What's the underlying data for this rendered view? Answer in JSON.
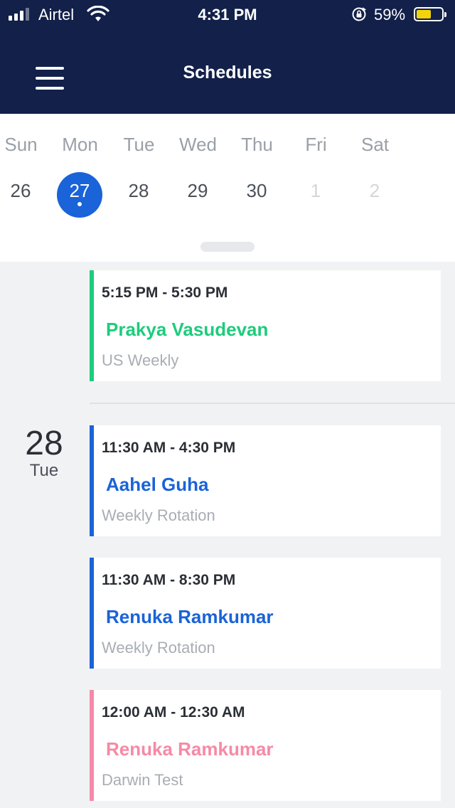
{
  "status_bar": {
    "carrier": "Airtel",
    "time": "4:31 PM",
    "battery": "59%",
    "battery_level": 0.59
  },
  "header": {
    "title": "Schedules"
  },
  "week": {
    "days": [
      {
        "name": "Sun",
        "num": "26"
      },
      {
        "name": "Mon",
        "num": "27"
      },
      {
        "name": "Tue",
        "num": "28"
      },
      {
        "name": "Wed",
        "num": "29"
      },
      {
        "name": "Thu",
        "num": "30"
      },
      {
        "name": "Fri",
        "num": "1"
      },
      {
        "name": "Sat",
        "num": "2"
      }
    ],
    "selected_index": 1
  },
  "schedule": {
    "groups": [
      {
        "date_num": "",
        "date_day": "",
        "items": [
          {
            "time": "5:15 PM - 5:30 PM",
            "name": "Prakya Vasudevan",
            "subtitle": "US Weekly",
            "color": "#1dcc7c"
          }
        ]
      },
      {
        "date_num": "28",
        "date_day": "Tue",
        "items": [
          {
            "time": "11:30 AM - 4:30 PM",
            "name": "Aahel Guha",
            "subtitle": "Weekly Rotation",
            "color": "#1a63d8"
          },
          {
            "time": "11:30 AM - 8:30 PM",
            "name": "Renuka Ramkumar",
            "subtitle": "Weekly Rotation",
            "color": "#1a63d8"
          },
          {
            "time": "12:00 AM - 12:30 AM",
            "name": "Renuka Ramkumar",
            "subtitle": "Darwin Test",
            "color": "#f58aa6"
          }
        ]
      }
    ]
  },
  "colors": {
    "header_bg": "#12204a",
    "accent": "#1a63d8",
    "green": "#1dcc7c",
    "pink": "#f58aa6"
  },
  "icons": [
    "signal-icon",
    "wifi-icon",
    "rotation-lock-icon",
    "battery-icon",
    "menu-icon"
  ]
}
